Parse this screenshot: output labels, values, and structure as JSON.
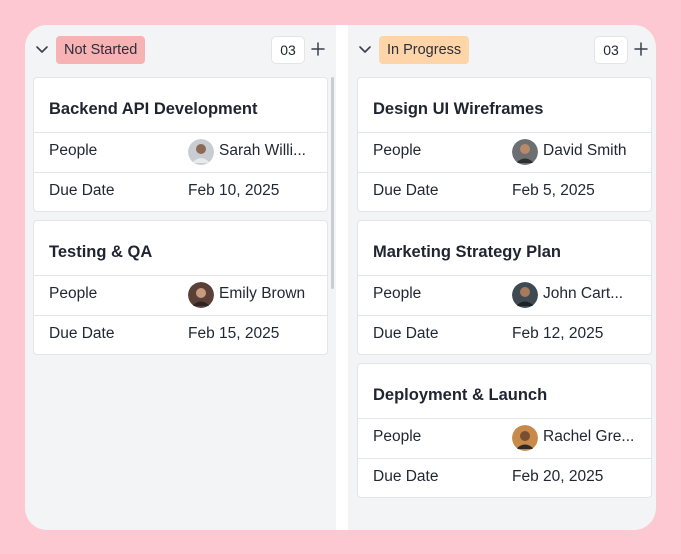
{
  "columns": [
    {
      "status": "Not Started",
      "count": "03",
      "cards": [
        {
          "title": "Backend API Development",
          "people_label": "People",
          "person": "Sarah Willi...",
          "due_label": "Due Date",
          "due": "Feb 10, 2025"
        },
        {
          "title": "Testing & QA",
          "people_label": "People",
          "person": "Emily Brown",
          "due_label": "Due Date",
          "due": "Feb 15, 2025"
        }
      ]
    },
    {
      "status": "In Progress",
      "count": "03",
      "cards": [
        {
          "title": "Design UI Wireframes",
          "people_label": "People",
          "person": "David Smith",
          "due_label": "Due Date",
          "due": "Feb 5, 2025"
        },
        {
          "title": "Marketing Strategy Plan",
          "people_label": "People",
          "person": "John Cart...",
          "due_label": "Due Date",
          "due": "Feb 12, 2025"
        },
        {
          "title": "Deployment & Launch",
          "people_label": "People",
          "person": "Rachel Gre...",
          "due_label": "Due Date",
          "due": "Feb 20, 2025"
        }
      ]
    }
  ],
  "colors": {
    "background": "#fec8d2",
    "not_started_badge": "#f7b2b4",
    "in_progress_badge": "#fdd5a8"
  },
  "icons": [
    "chevron-down-icon",
    "plus-icon",
    "avatar"
  ]
}
